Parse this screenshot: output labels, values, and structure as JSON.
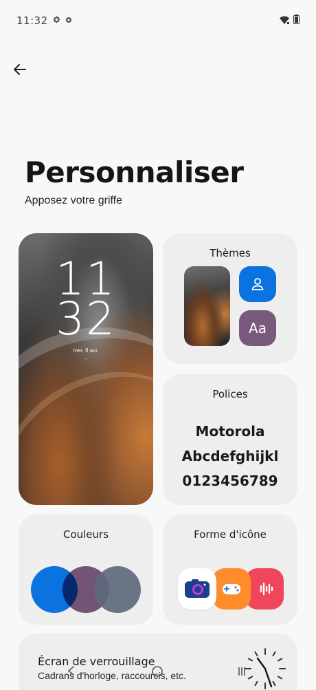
{
  "status_bar": {
    "time": "11:32",
    "icons": [
      "settings-gear-icon",
      "notification-dot-icon",
      "wifi-icon",
      "battery-icon"
    ]
  },
  "header": {
    "back_icon": "arrow-left-icon",
    "title": "Personnaliser",
    "subtitle": "Apposez votre griffe"
  },
  "lock_preview": {
    "hour": "11",
    "minute": "32",
    "date": "mer. 8 avr.",
    "dash": "--"
  },
  "themes": {
    "title": "Thèmes",
    "icons": [
      "person-icon"
    ],
    "font_sample": "Aa",
    "colors": {
      "blue": "#0b73e0",
      "mauve": "#7a5a7c"
    }
  },
  "fonts": {
    "title": "Polices",
    "samples": [
      "Motorola",
      "Abcdefghijkl",
      "0123456789"
    ]
  },
  "colors": {
    "title": "Couleurs",
    "swatches": [
      "#0b73e0",
      "#7a5a7c",
      "#5d6a7c"
    ]
  },
  "icon_shape": {
    "title": "Forme d'icône",
    "icons": [
      "camera-icon",
      "game-controller-icon",
      "voice-recorder-icon"
    ],
    "colors": [
      "#ffffff",
      "#ff8c2a",
      "#f0455a"
    ]
  },
  "lock_screen": {
    "title": "Écran de verrouillage",
    "subtitle": "Cadrans d'horloge, raccourcis, etc.",
    "icon": "analog-clock-icon"
  },
  "nav": {
    "icons": [
      "nav-back-icon",
      "nav-home-icon",
      "nav-recents-icon"
    ]
  }
}
